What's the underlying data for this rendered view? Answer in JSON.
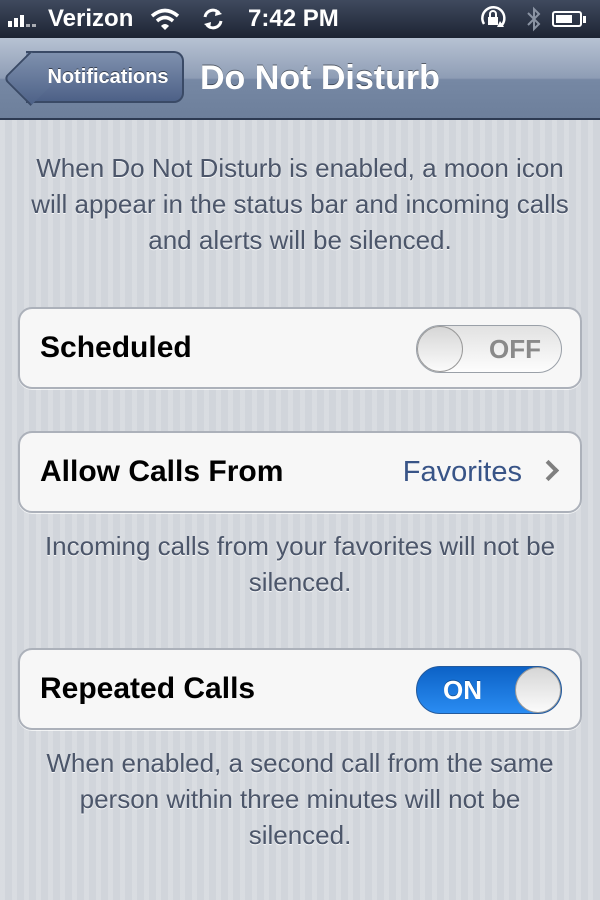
{
  "status_bar": {
    "carrier": "Verizon",
    "time": "7:42 PM",
    "icons": [
      "signal-icon",
      "wifi-icon",
      "sync-icon",
      "rotation-lock-icon",
      "bluetooth-icon",
      "battery-icon"
    ]
  },
  "nav": {
    "back_label": "Notifications",
    "title": "Do Not Disturb"
  },
  "header_text": "When Do Not Disturb is enabled, a moon icon will appear in the status bar and incoming calls and alerts will be silenced.",
  "scheduled": {
    "label": "Scheduled",
    "toggle_text": "OFF",
    "state": "off"
  },
  "allow_calls": {
    "label": "Allow Calls From",
    "value": "Favorites",
    "footer": "Incoming calls from your favorites will not be silenced."
  },
  "repeated_calls": {
    "label": "Repeated Calls",
    "toggle_text": "ON",
    "state": "on",
    "footer": "When enabled, a second call from the same person within three minutes will not be silenced."
  },
  "colors": {
    "nav_bar": "#7688a4",
    "accent_blue": "#385487",
    "toggle_on": "#1a78e0"
  }
}
